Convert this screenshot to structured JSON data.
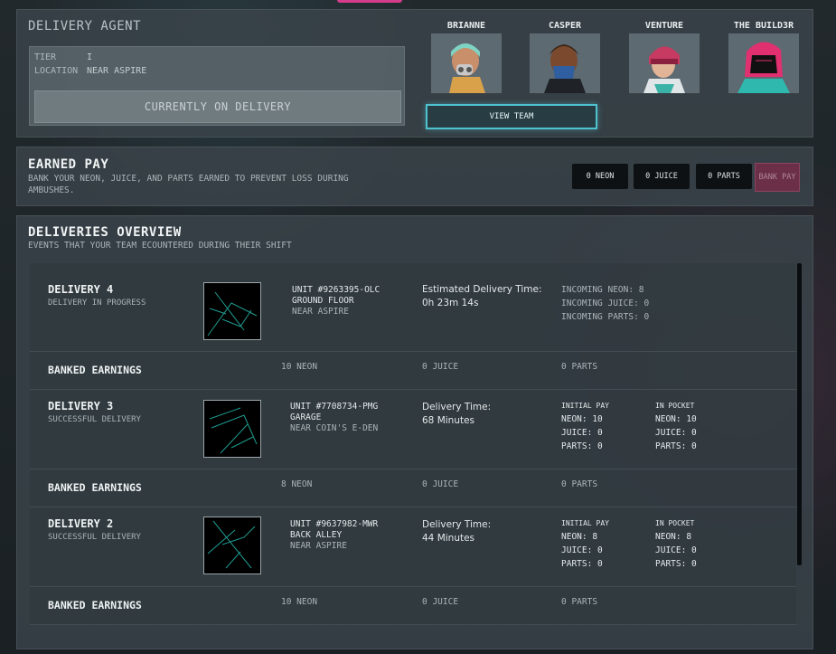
{
  "agent": {
    "title": "DELIVERY AGENT",
    "tier_label": "TIER",
    "tier_value": "I",
    "location_label": "LOCATION",
    "location_value": "NEAR ASPIRE",
    "status_button": "CURRENTLY ON DELIVERY"
  },
  "team": {
    "members": [
      {
        "name": "BRIANNE",
        "portrait": "brianne-portrait"
      },
      {
        "name": "CASPER",
        "portrait": "casper-portrait"
      },
      {
        "name": "VENTURE",
        "portrait": "venture-portrait"
      },
      {
        "name": "THE BUILD3R",
        "portrait": "builder-portrait"
      }
    ],
    "view_team_button": "VIEW TEAM"
  },
  "earned_pay": {
    "title": "EARNED PAY",
    "subtitle": "BANK YOUR NEON, JUICE, AND PARTS EARNED TO PREVENT LOSS DURING AMBUSHES.",
    "neon": "0 NEON",
    "juice": "0 JUICE",
    "parts": "0 PARTS",
    "bank_button": "BANK PAY"
  },
  "deliveries": {
    "title": "DELIVERIES OVERVIEW",
    "subtitle": "EVENTS THAT YOUR TEAM ECOUNTERED DURING THEIR SHIFT",
    "banked_label": "BANKED EARNINGS",
    "items": [
      {
        "name": "DELIVERY 4",
        "status": "DELIVERY IN PROGRESS",
        "unit": "UNIT #9263395-OLC",
        "floor": "GROUND FLOOR",
        "location": "NEAR ASPIRE",
        "time_label": "Estimated Delivery Time:",
        "time_value": "0h 23m 14s",
        "incoming_neon": "INCOMING NEON: 8",
        "incoming_juice": "INCOMING JUICE: 0",
        "incoming_parts": "INCOMING PARTS: 0",
        "banked_neon": "10 NEON",
        "banked_juice": "0 JUICE",
        "banked_parts": "0 PARTS"
      },
      {
        "name": "DELIVERY 3",
        "status": "SUCCESSFUL DELIVERY",
        "unit": "UNIT #7708734-PMG",
        "floor": "GARAGE",
        "location": "NEAR COIN'S E-DEN",
        "time_label": "Delivery Time:",
        "time_value": "68 Minutes",
        "initial_header": "INITIAL PAY",
        "initial_neon": "NEON: 10",
        "initial_juice": "JUICE: 0",
        "initial_parts": "PARTS: 0",
        "pocket_header": "IN POCKET",
        "pocket_neon": "NEON: 10",
        "pocket_juice": "JUICE: 0",
        "pocket_parts": "PARTS: 0",
        "banked_neon": "8 NEON",
        "banked_juice": "0 JUICE",
        "banked_parts": "0 PARTS"
      },
      {
        "name": "DELIVERY 2",
        "status": "SUCCESSFUL DELIVERY",
        "unit": "UNIT #9637982-MWR",
        "floor": "BACK ALLEY",
        "location": "NEAR ASPIRE",
        "time_label": "Delivery Time:",
        "time_value": "44 Minutes",
        "initial_header": "INITIAL PAY",
        "initial_neon": "NEON: 8",
        "initial_juice": "JUICE: 0",
        "initial_parts": "PARTS: 0",
        "pocket_header": "IN POCKET",
        "pocket_neon": "NEON: 8",
        "pocket_juice": "JUICE: 0",
        "pocket_parts": "PARTS: 0",
        "banked_neon": "10 NEON",
        "banked_juice": "0 JUICE",
        "banked_parts": "0 PARTS"
      }
    ]
  },
  "colors": {
    "accent_cyan": "#4fc2d0",
    "accent_pink": "#d63c8c",
    "bank_button": "#6b2f47"
  }
}
